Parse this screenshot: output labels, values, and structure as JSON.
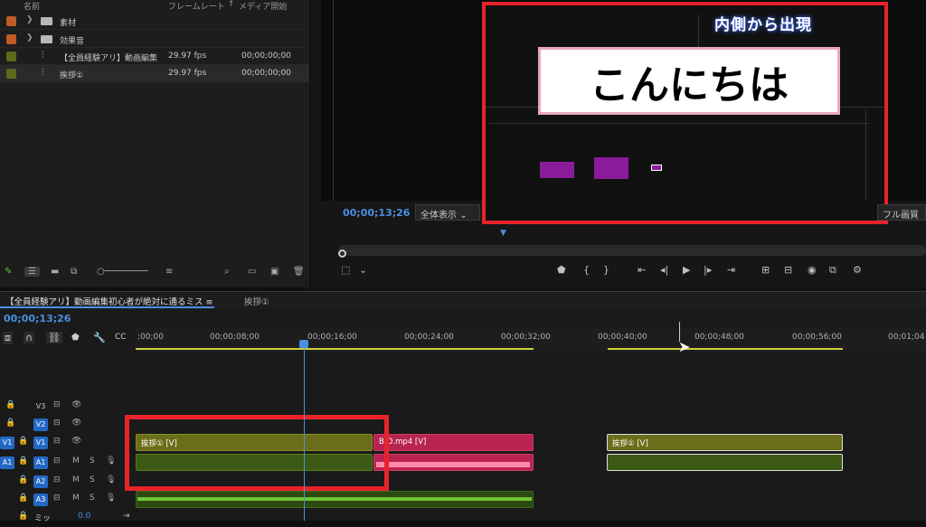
{
  "project_panel": {
    "headers": {
      "name": "名前",
      "framerate": "フレームレート",
      "sort_icon": "↑",
      "media_start": "メディア開始"
    },
    "items": [
      {
        "label": "素材",
        "type": "folder",
        "color": "#c05a26"
      },
      {
        "label": "効果音",
        "type": "folder",
        "color": "#c05a26"
      },
      {
        "label": "【全員経験アリ】動画編集",
        "type": "sequence",
        "color": "#5b6b1c",
        "fps": "29.97 fps",
        "start": "00;00;00;00"
      },
      {
        "label": "挨拶①",
        "type": "sequence",
        "color": "#5b6b1c",
        "fps": "29.97 fps",
        "start": "00;00;00;00"
      }
    ]
  },
  "program_monitor": {
    "timecode": "00;00;13;26",
    "fit_option": "全体表示",
    "quality_option": "フル画質",
    "inset_title": "内側から出現",
    "inset_text": "こんにちは"
  },
  "timeline": {
    "tabs": [
      {
        "label": "【全員経験アリ】動画編集初心者が絶対に通るミス ≡"
      },
      {
        "label": "挨拶①"
      }
    ],
    "timecode": "00;00;13;26",
    "ruler": [
      ";00;00",
      "00;00;08;00",
      "00;00;16;00",
      "00;00;24;00",
      "00;00;32;00",
      "00;00;40;00",
      "00;00;48;00",
      "00;00;56;00",
      "00;01;04"
    ],
    "tracks": {
      "v3": "V3",
      "v2": "V2",
      "v1": "V1",
      "a1": "A1",
      "a2": "A2",
      "a3": "A3",
      "src_v1": "V1",
      "src_a1": "A1",
      "m": "M",
      "s": "S",
      "mix": "ミッ",
      "mix_value": "0.0"
    },
    "clips": {
      "v1_a": "挨拶① [V]",
      "v1_b": "B-D.mp4 [V]",
      "v1_c": "挨拶① [V]"
    }
  }
}
